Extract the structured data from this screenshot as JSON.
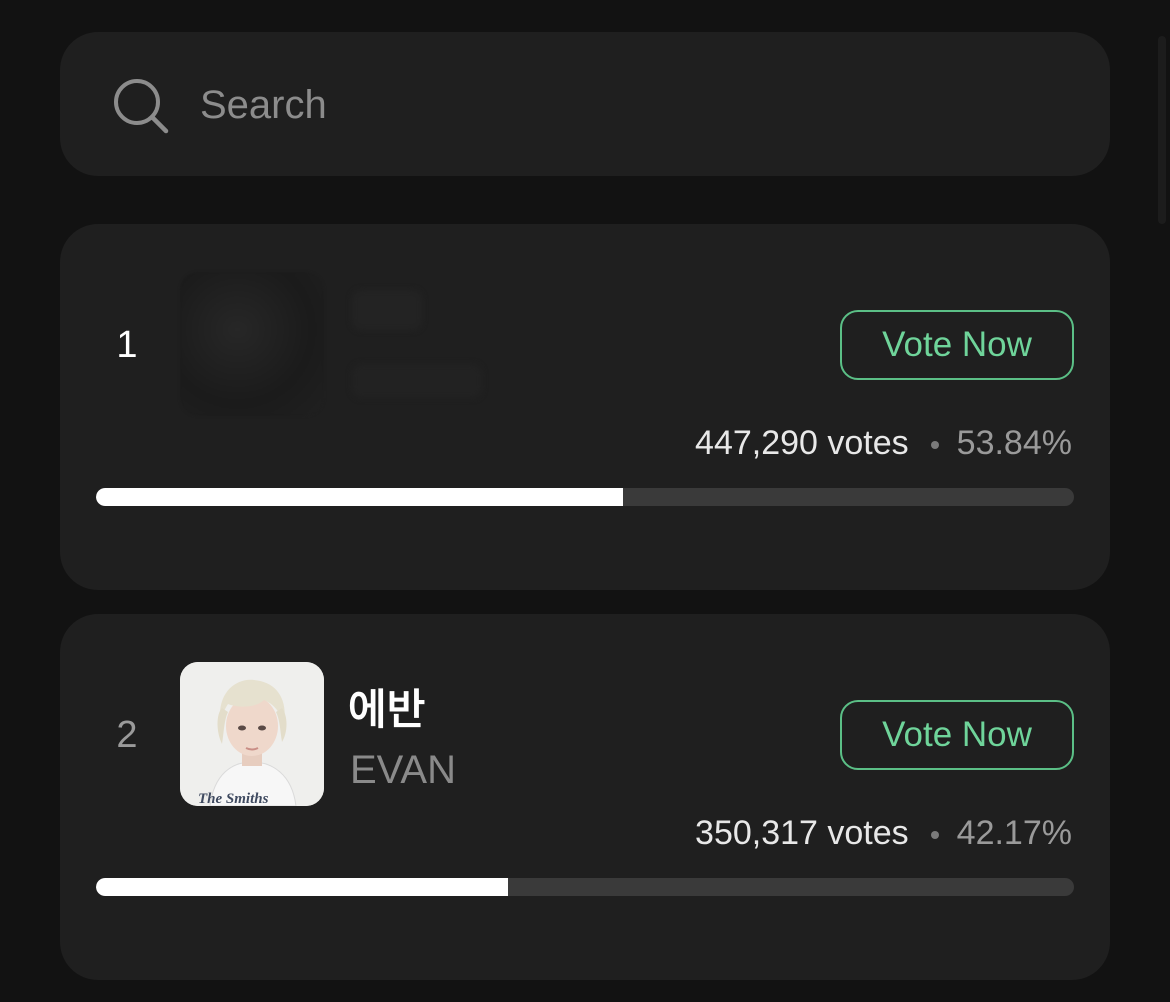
{
  "search": {
    "placeholder": "Search"
  },
  "entries": [
    {
      "rank": "1",
      "name": "",
      "subname": "",
      "name_obscured": true,
      "vote_button_label": "Vote Now",
      "votes_text": "447,290 votes",
      "percent_text": "53.84%",
      "progress": 0.5384
    },
    {
      "rank": "2",
      "name": "에반",
      "subname": "EVAN",
      "name_obscured": false,
      "vote_button_label": "Vote Now",
      "votes_text": "350,317 votes",
      "percent_text": "42.17%",
      "progress": 0.4217
    }
  ],
  "icons": {
    "search": "search-icon"
  },
  "colors": {
    "background": "#121212",
    "card": "#1f1f1f",
    "accent": "#6fd49a",
    "progress_fill": "#ffffff",
    "progress_track": "#3a3a3a"
  }
}
